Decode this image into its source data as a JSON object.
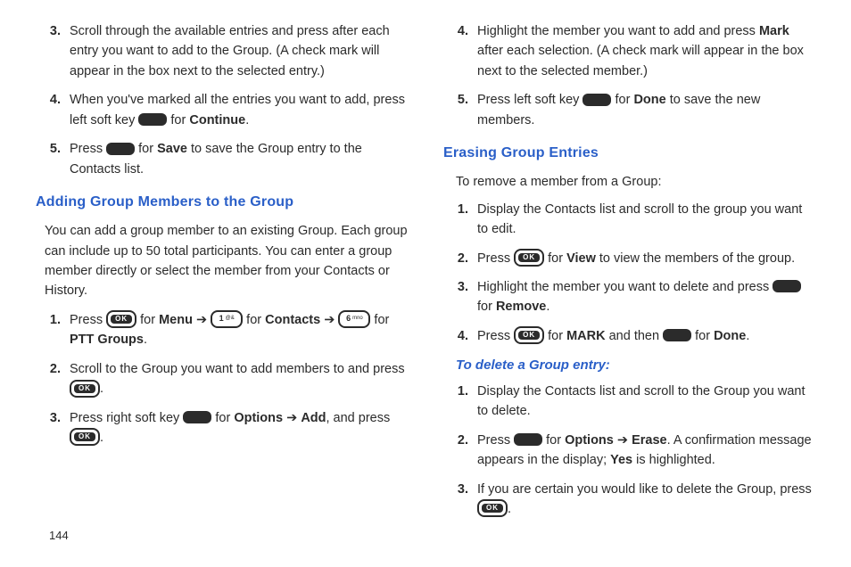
{
  "page_number": "144",
  "left": {
    "top_list": [
      {
        "num": "3.",
        "parts": [
          "Scroll through the available entries and press after each entry you want to add to the Group. (A check mark will appear in the box next to the selected entry.)"
        ]
      },
      {
        "num": "4.",
        "parts": [
          "When you've marked all the entries you want to add, press left soft key ",
          {
            "icon": "softkey"
          },
          " for ",
          {
            "b": "Continue"
          },
          "."
        ]
      },
      {
        "num": "5.",
        "parts": [
          "Press ",
          {
            "icon": "softkey"
          },
          " for ",
          {
            "b": "Save"
          },
          " to save the Group entry to the Contacts list."
        ]
      }
    ],
    "h3": "Adding Group Members to the Group",
    "intro": "You can add a group member to an existing Group. Each group can include up to 50 total participants. You can enter a group member directly or select the member from your Contacts or History.",
    "list": [
      {
        "num": "1.",
        "parts": [
          "Press ",
          {
            "icon": "ok"
          },
          " for ",
          {
            "b": "Menu"
          },
          " ➔ ",
          {
            "icon": "key1"
          },
          " for ",
          {
            "b": "Contacts"
          },
          " ➔ ",
          {
            "icon": "key6"
          },
          " for ",
          {
            "b": "PTT Groups"
          },
          "."
        ]
      },
      {
        "num": "2.",
        "parts": [
          "Scroll to the Group you want to add members to and press ",
          {
            "icon": "ok"
          },
          "."
        ]
      },
      {
        "num": "3.",
        "parts": [
          "Press right soft key ",
          {
            "icon": "softkey"
          },
          " for ",
          {
            "b": "Options"
          },
          " ➔ ",
          {
            "b": "Add"
          },
          ", and press ",
          {
            "icon": "ok"
          },
          "."
        ]
      }
    ]
  },
  "right": {
    "top_list": [
      {
        "num": "4.",
        "parts": [
          "Highlight the member you want to add and press ",
          {
            "b": "Mark"
          },
          " after each selection. (A check mark will appear in the box next to the selected member.)"
        ]
      },
      {
        "num": "5.",
        "parts": [
          "Press left soft key ",
          {
            "icon": "softkey"
          },
          " for ",
          {
            "b": "Done"
          },
          " to save the new members."
        ]
      }
    ],
    "h3": "Erasing Group Entries",
    "intro": "To remove a member from a Group:",
    "list": [
      {
        "num": "1.",
        "parts": [
          "Display the Contacts list and scroll to the group you want to edit."
        ]
      },
      {
        "num": "2.",
        "parts": [
          "Press ",
          {
            "icon": "ok"
          },
          " for ",
          {
            "b": "View"
          },
          " to view the members of the group."
        ]
      },
      {
        "num": "3.",
        "parts": [
          "Highlight the member you want to delete and press ",
          {
            "icon": "softkey"
          },
          " for ",
          {
            "b": "Remove"
          },
          "."
        ]
      },
      {
        "num": "4.",
        "parts": [
          "Press ",
          {
            "icon": "ok"
          },
          " for ",
          {
            "b": "MARK"
          },
          " and then ",
          {
            "icon": "softkey"
          },
          " for ",
          {
            "b": "Done"
          },
          "."
        ]
      }
    ],
    "h4": "To delete a Group entry:",
    "list2": [
      {
        "num": "1.",
        "parts": [
          "Display the Contacts list and scroll to the Group you want to delete."
        ]
      },
      {
        "num": "2.",
        "parts": [
          "Press ",
          {
            "icon": "softkey"
          },
          " for ",
          {
            "b": "Options"
          },
          " ➔ ",
          {
            "b": "Erase"
          },
          ". A confirmation message appears in the display; ",
          {
            "b": "Yes"
          },
          " is highlighted."
        ]
      },
      {
        "num": "3.",
        "parts": [
          "If you are certain you would like to delete the Group, press ",
          {
            "icon": "ok"
          },
          "."
        ]
      }
    ]
  },
  "icons": {
    "ok_label": "OK",
    "key1_digit": "1",
    "key1_sub": "@&",
    "key6_digit": "6",
    "key6_sub": "mno"
  }
}
